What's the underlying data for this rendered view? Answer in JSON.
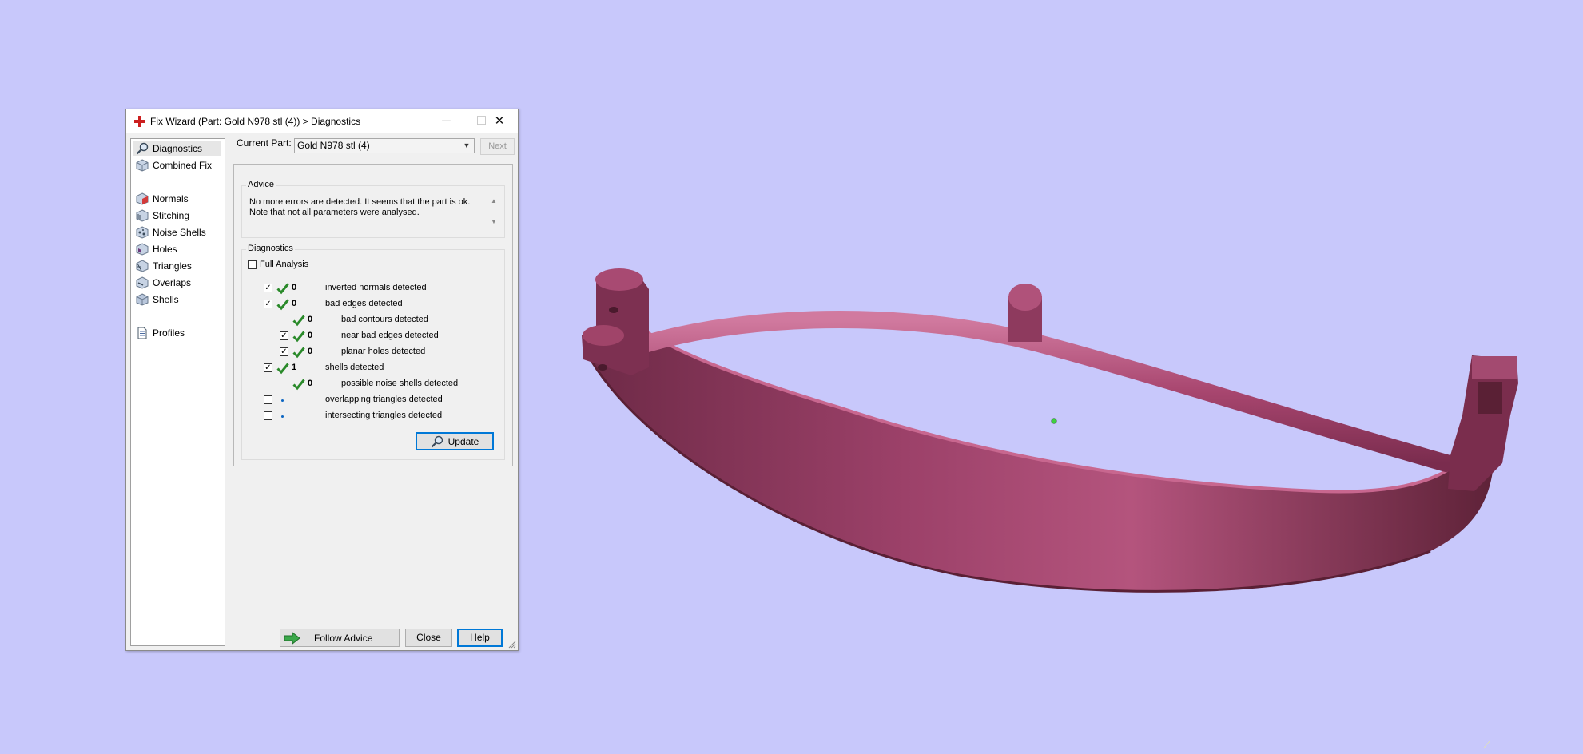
{
  "dialog": {
    "title": "Fix Wizard (Part: Gold N978 stl (4)) > Diagnostics",
    "window_buttons": {
      "minimize": "─",
      "maximize": "☐",
      "close": "✕"
    }
  },
  "nav": {
    "items": [
      {
        "label": "Diagnostics",
        "icon": "magnifier-icon",
        "selected": true
      },
      {
        "label": "Combined Fix",
        "icon": "cube-icon"
      },
      {
        "label": "Normals",
        "icon": "cube-normals-icon"
      },
      {
        "label": "Stitching",
        "icon": "cube-stitching-icon"
      },
      {
        "label": "Noise Shells",
        "icon": "cube-noise-icon"
      },
      {
        "label": "Holes",
        "icon": "cube-holes-icon"
      },
      {
        "label": "Triangles",
        "icon": "cube-triangles-icon"
      },
      {
        "label": "Overlaps",
        "icon": "cube-overlaps-icon"
      },
      {
        "label": "Shells",
        "icon": "cube-shells-icon"
      },
      {
        "label": "Profiles",
        "icon": "document-icon"
      }
    ]
  },
  "current_part": {
    "label": "Current Part:",
    "value": "Gold N978 stl (4)",
    "next_label": "Next"
  },
  "advice": {
    "title": "Advice",
    "text": "No more errors are detected. It seems that the part is ok. Note that not all parameters were analysed."
  },
  "diagnostics": {
    "title": "Diagnostics",
    "full_analysis_label": "Full Analysis",
    "full_analysis_checked": false,
    "rows": [
      {
        "checkbox": true,
        "checked": true,
        "status": "ok",
        "count": "0",
        "label": "inverted normals detected",
        "indent": 0
      },
      {
        "checkbox": true,
        "checked": true,
        "status": "ok",
        "count": "0",
        "label": "bad edges detected",
        "indent": 0
      },
      {
        "checkbox": false,
        "status": "ok",
        "count": "0",
        "label": "bad contours detected",
        "indent": 1
      },
      {
        "checkbox": true,
        "checked": true,
        "status": "ok",
        "count": "0",
        "label": "near bad edges detected",
        "indent": 1
      },
      {
        "checkbox": true,
        "checked": true,
        "status": "ok",
        "count": "0",
        "label": "planar holes detected",
        "indent": 1
      },
      {
        "checkbox": true,
        "checked": true,
        "status": "ok",
        "count": "1",
        "label": "shells detected",
        "indent": 0
      },
      {
        "checkbox": false,
        "status": "ok",
        "count": "0",
        "label": "possible noise shells detected",
        "indent": 1
      },
      {
        "checkbox": true,
        "checked": false,
        "status": "not-analysed",
        "count": "",
        "label": "overlapping triangles detected",
        "indent": 0
      },
      {
        "checkbox": true,
        "checked": false,
        "status": "not-analysed",
        "count": "",
        "label": "intersecting triangles detected",
        "indent": 0
      }
    ],
    "update_label": "Update"
  },
  "footer": {
    "follow_advice_label": "Follow Advice",
    "close_label": "Close",
    "help_label": "Help"
  },
  "colors": {
    "background": "#c8c8fb",
    "model": "#a8466f",
    "ok_tick": "#2a8a2a",
    "focus": "#0078d7"
  }
}
